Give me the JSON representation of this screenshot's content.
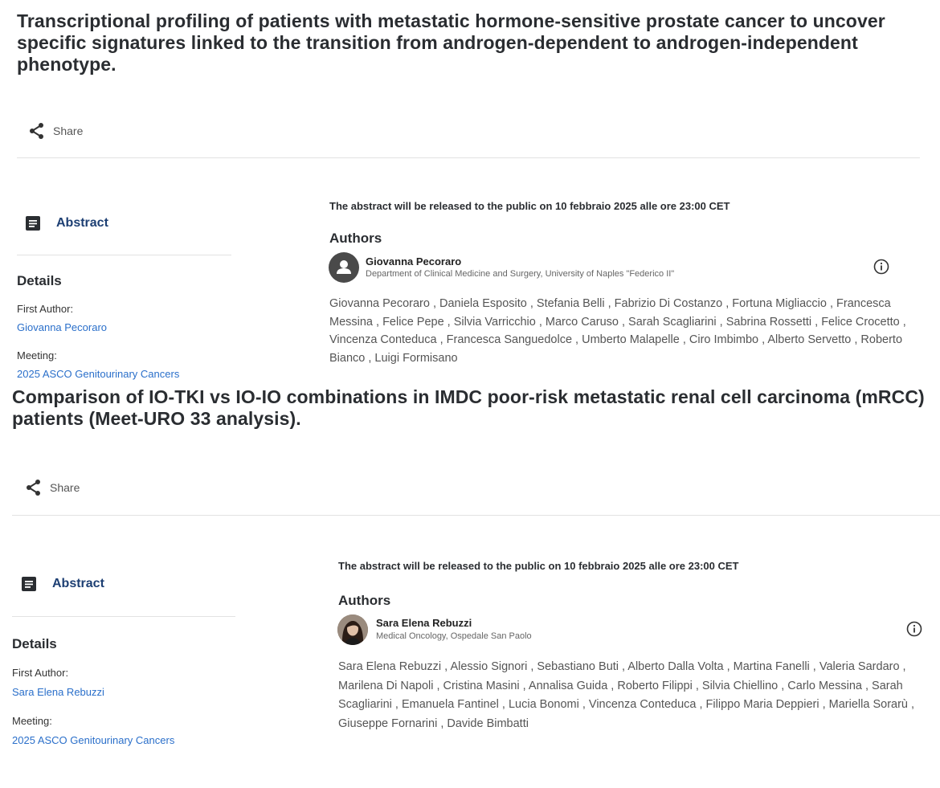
{
  "cards": [
    {
      "title": "Transcriptional profiling of patients with metastatic hormone-sensitive prostate cancer to uncover specific signatures linked to the transition from androgen-dependent to androgen-independent phenotype.",
      "share_label": "Share",
      "tab_label": "Abstract",
      "details_heading": "Details",
      "first_author_label": "First Author:",
      "first_author": "Giovanna Pecoraro",
      "meeting_label": "Meeting:",
      "meeting": "2025 ASCO Genitourinary Cancers",
      "notice": "The abstract will be released to the public on 10 febbraio 2025 alle ore 23:00 CET",
      "authors_heading": "Authors",
      "primary_author": {
        "name": "Giovanna Pecoraro",
        "affiliation": "Department of Clinical Medicine and Surgery, University of Naples \"Federico II\"",
        "avatar": "person-placeholder-icon"
      },
      "authors_list": "Giovanna Pecoraro , Daniela Esposito , Stefania Belli , Fabrizio Di Costanzo , Fortuna Migliaccio , Francesca Messina , Felice Pepe , Silvia Varricchio , Marco Caruso , Sarah Scagliarini , Sabrina Rossetti , Felice Crocetto , Vincenza Conteduca , Francesca Sanguedolce , Umberto Malapelle , Ciro Imbimbo , Alberto Servetto , Roberto Bianco , Luigi Formisano"
    },
    {
      "title": "Comparison of IO-TKI vs IO-IO combinations in IMDC poor-risk metastatic renal cell carcinoma (mRCC) patients (Meet-URO 33 analysis).",
      "share_label": "Share",
      "tab_label": "Abstract",
      "details_heading": "Details",
      "first_author_label": "First Author:",
      "first_author": "Sara Elena Rebuzzi",
      "meeting_label": "Meeting:",
      "meeting": "2025 ASCO Genitourinary Cancers",
      "notice": "The abstract will be released to the public on 10 febbraio 2025 alle ore 23:00 CET",
      "authors_heading": "Authors",
      "primary_author": {
        "name": "Sara Elena Rebuzzi",
        "affiliation": "Medical Oncology, Ospedale San Paolo",
        "avatar": "author-photo"
      },
      "authors_list": "Sara Elena Rebuzzi , Alessio Signori , Sebastiano Buti , Alberto Dalla Volta , Martina Fanelli , Valeria Sardaro , Marilena Di Napoli , Cristina Masini , Annalisa Guida , Roberto Filippi , Silvia Chiellino , Carlo Messina , Sarah Scagliarini , Emanuela Fantinel , Lucia Bonomi , Vincenza Conteduca , Filippo Maria Deppieri , Mariella Sorarù , Giuseppe Fornarini , Davide Bimbatti"
    }
  ],
  "colors": {
    "link": "#2a6fca",
    "tab": "#1d3f73",
    "title": "#2a2d31"
  }
}
